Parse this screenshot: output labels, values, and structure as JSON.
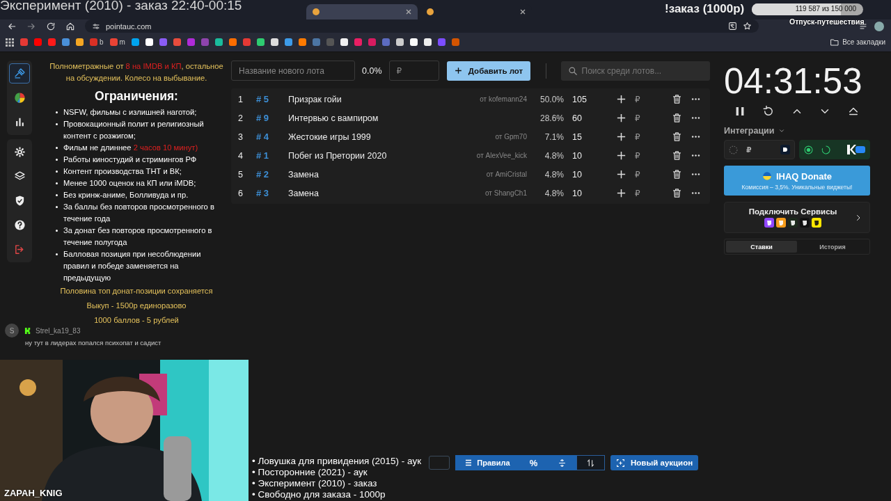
{
  "stream_overlay": {
    "title": "Эксперимент (2010) - заказ 22:40-00:15",
    "goal": {
      "label": "!заказ (1000р)",
      "progress": "119 587 из 150 000",
      "level": 0.8,
      "caption": "Отпуск-путешествия"
    },
    "chat": {
      "avatar": "S",
      "user": "Strel_ka19_83",
      "message": "ну тут в лидерах попался психопат и садист"
    },
    "webcam": {
      "kind": "picture",
      "label": "ZAPAH_KNIG"
    },
    "queue": [
      "• Ловушка для привидения (2015) - аук",
      "• Посторонние (2021) - аук",
      "• Эксперимент (2010) - заказ",
      "• Свободно для заказа - 1000р"
    ]
  },
  "browser": {
    "tabs": [
      {
        "selected": true
      },
      {
        "selected": false
      }
    ],
    "url": "pointauc.com",
    "bookmarks": [
      {
        "color": "#e53935"
      },
      {
        "color": "#ff0000"
      },
      {
        "color": "#ff1a1a"
      },
      {
        "color": "#4a90d9"
      },
      {
        "color": "#f5a623"
      },
      {
        "color": "#d93025",
        "label": "b"
      },
      {
        "color": "#ea4335",
        "label": "m"
      },
      {
        "color": "#00a4ef"
      },
      {
        "color": "#ffffff"
      },
      {
        "color": "#8a5cf5"
      },
      {
        "color": "#e84c3d"
      },
      {
        "color": "#b02bd8"
      },
      {
        "color": "#8e44ad"
      },
      {
        "color": "#1abc9c"
      },
      {
        "color": "#ff6d00"
      },
      {
        "color": "#e53935"
      },
      {
        "color": "#2ecc71"
      },
      {
        "color": "#dddddd"
      },
      {
        "color": "#3d9be9"
      },
      {
        "color": "#ff7a00"
      },
      {
        "color": "#4c75a3"
      },
      {
        "color": "#555555"
      },
      {
        "color": "#f0f0f0"
      },
      {
        "color": "#e91e63"
      },
      {
        "color": "#d81b60"
      },
      {
        "color": "#5c6bc0"
      },
      {
        "color": "#cccccc"
      },
      {
        "color": "#fafafa"
      },
      {
        "color": "#eeeeee"
      },
      {
        "color": "#7c4dff"
      },
      {
        "color": "#d35400"
      }
    ],
    "all_bookmarks": "Все закладки"
  },
  "sidebar": {
    "groups": [
      {
        "items": [
          {
            "kind": "auction",
            "selected": true
          },
          {
            "kind": "pie",
            "selected": false
          },
          {
            "kind": "stats",
            "selected": false
          }
        ]
      },
      {
        "items": [
          {
            "kind": "settings",
            "selected": false
          },
          {
            "kind": "layers",
            "selected": false
          },
          {
            "kind": "shield",
            "selected": false
          },
          {
            "kind": "help",
            "selected": false
          },
          {
            "kind": "logout",
            "selected": false
          }
        ]
      }
    ]
  },
  "rules": {
    "intro": [
      {
        "text": "Полнометражные от ",
        "accent": false
      },
      {
        "text": "8 на IMDB и КП",
        "accent": true
      },
      {
        "text": ", остальное на обсуждении. Колесо на выбывание.",
        "accent": false
      }
    ],
    "heading": "Ограничения:",
    "items": [
      [
        {
          "text": "NSFW, фильмы с излишней наготой;",
          "accent": false
        }
      ],
      [
        {
          "text": "Провокационный полит и религиозный контент с розжигом;",
          "accent": false
        }
      ],
      [
        {
          "text": "Фильм не длиннее ",
          "accent": false
        },
        {
          "text": "2 часов 10 минут)",
          "accent": true
        }
      ],
      [
        {
          "text": "Работы киностудий и стримингов РФ",
          "accent": false
        }
      ],
      [
        {
          "text": "Контент производства ТНТ и ВК;",
          "accent": false
        }
      ],
      [
        {
          "text": "Менее 1000 оценок на КП или iMDB;",
          "accent": false
        }
      ],
      [
        {
          "text": "Без кринж-аниме, Болливуда и пр.",
          "accent": false
        }
      ],
      [
        {
          "text": "За баллы без повторов просмотренного в течение года",
          "accent": false
        }
      ],
      [
        {
          "text": "За донат без повторов просмотренного в течение полугода",
          "accent": false
        }
      ],
      [
        {
          "text": "Балловая позиция при несоблюдении правил и победе заменяется на предыдущую",
          "accent": false
        }
      ]
    ],
    "footer": [
      "Половина топ донат-позиции сохраняется",
      "Выкуп - 1500р единоразово",
      "1000 баллов - 5 рублей"
    ]
  },
  "new_lot": {
    "placeholder": "Название нового лота",
    "percent": "0.0%",
    "amount_placeholder": "₽",
    "add_button": "Добавить лот",
    "search_placeholder": "Поиск среди лотов..."
  },
  "lots": [
    {
      "rank": "1",
      "id": "# 5",
      "name": "Призрак гойи",
      "author": "от kofemann24",
      "percent": "50.0%",
      "amount": "105",
      "currency": "₽"
    },
    {
      "rank": "2",
      "id": "# 9",
      "name": "Интервью с вампиром",
      "percent": "28.6%",
      "amount": "60",
      "currency": "₽"
    },
    {
      "rank": "3",
      "id": "# 4",
      "name": "Жестокие игры 1999",
      "author": "от Gpm70",
      "percent": "7.1%",
      "amount": "15",
      "currency": "₽"
    },
    {
      "rank": "4",
      "id": "# 1",
      "name": "Побег из Претории 2020",
      "author": "от AlexVee_kick",
      "percent": "4.8%",
      "amount": "10",
      "currency": "₽"
    },
    {
      "rank": "5",
      "id": "# 2",
      "name": "Замена",
      "author": "от AmiCristal",
      "percent": "4.8%",
      "amount": "10",
      "currency": "₽"
    },
    {
      "rank": "6",
      "id": "# 3",
      "name": "Замена",
      "author": "от ShangCh1",
      "percent": "4.8%",
      "amount": "10",
      "currency": "₽"
    }
  ],
  "bottom_toolbar": {
    "rules_button": "Правила",
    "toggles": [
      {
        "kind": "percent",
        "label": "%",
        "selected": true
      },
      {
        "kind": "split",
        "selected": true
      },
      {
        "kind": "sort",
        "selected": false
      }
    ],
    "new_auction": "Новый аукцион"
  },
  "timer": {
    "time": "04:31:53"
  },
  "integrations": {
    "label": "Интеграции",
    "cards": [
      {
        "currency": "₽",
        "enabled": false
      },
      {
        "enabled": true
      }
    ]
  },
  "promo": {
    "title": "IHAQ Donate",
    "subtitle": "Комиссия – 3,5%. Уникальные виджеты!"
  },
  "services": {
    "title": "Подключить Сервисы"
  },
  "tabs": [
    {
      "label": "Ставки",
      "selected": true
    },
    {
      "label": "История",
      "selected": false
    }
  ]
}
